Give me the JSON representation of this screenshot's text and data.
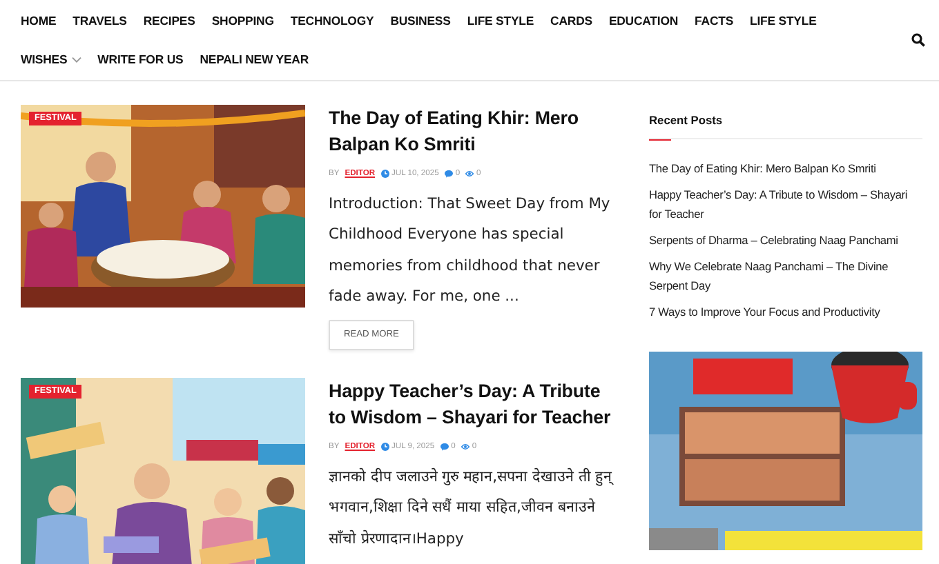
{
  "nav": {
    "items": [
      {
        "label": "HOME",
        "dropdown": false
      },
      {
        "label": "TRAVELS",
        "dropdown": false
      },
      {
        "label": "RECIPES",
        "dropdown": false
      },
      {
        "label": "SHOPPING",
        "dropdown": false
      },
      {
        "label": "TECHNOLOGY",
        "dropdown": false
      },
      {
        "label": "BUSINESS",
        "dropdown": false
      },
      {
        "label": "LIFE STYLE",
        "dropdown": false
      },
      {
        "label": "CARDS",
        "dropdown": false
      },
      {
        "label": "EDUCATION",
        "dropdown": false
      },
      {
        "label": "FACTS",
        "dropdown": false
      },
      {
        "label": "LIFE STYLE",
        "dropdown": false
      },
      {
        "label": "WISHES",
        "dropdown": true
      },
      {
        "label": "WRITE FOR US",
        "dropdown": false
      },
      {
        "label": "NEPALI NEW YEAR",
        "dropdown": false
      }
    ]
  },
  "posts": [
    {
      "category": "FESTIVAL",
      "title": "The Day of Eating Khir: Mero Balpan Ko Smriti",
      "by": "BY",
      "author": "EDITOR",
      "date": "JUL 10, 2025",
      "comments": "0",
      "views": "0",
      "excerpt": "Introduction: That Sweet Day from My Childhood Everyone has special memories from childhood that never fade away. For me, one ...",
      "button": "READ MORE"
    },
    {
      "category": "FESTIVAL",
      "title": "Happy Teacher’s Day: A Tribute to Wisdom – Shayari for Teacher",
      "by": "BY",
      "author": "EDITOR",
      "date": "JUL 9, 2025",
      "comments": "0",
      "views": "0",
      "excerpt": "ज्ञानको दीप जलाउने गुरु महान,सपना देखाउने ती हुन् भगवान,शिक्षा दिने सधैं माया सहित,जीवन बनाउने साँचो प्रेरणादान।Happy"
    }
  ],
  "sidebar": {
    "title": "Recent Posts",
    "posts": [
      "The Day of Eating Khir: Mero Balpan Ko Smriti",
      "Happy Teacher’s Day: A Tribute to Wisdom – Shayari for Teacher",
      "Serpents of Dharma – Celebrating Naag Panchami",
      "Why We Celebrate Naag Panchami – The Divine Serpent Day",
      "7 Ways to Improve Your Focus and Productivity"
    ]
  }
}
